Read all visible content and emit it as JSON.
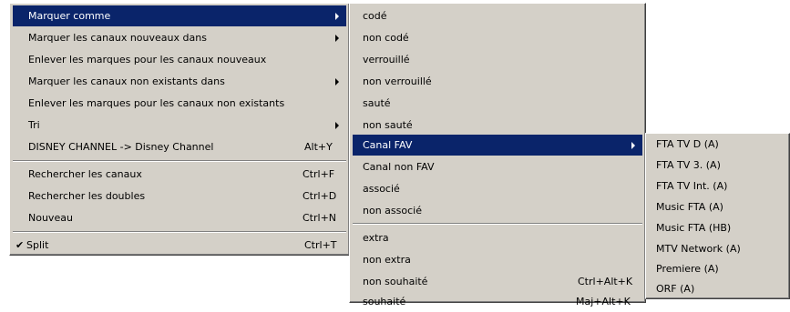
{
  "menu1": {
    "items": [
      {
        "label": "Marquer comme"
      },
      {
        "label": "Marquer les canaux nouveaux dans"
      },
      {
        "label": "Enlever les marques pour les canaux nouveaux"
      },
      {
        "label": "Marquer les canaux non existants dans"
      },
      {
        "label": "Enlever les marques pour les canaux non existants"
      },
      {
        "label": "Tri"
      },
      {
        "label": "DISNEY CHANNEL -> Disney Channel",
        "shortcut": "Alt+Y"
      },
      {
        "label": "Rechercher les canaux",
        "shortcut": "Ctrl+F"
      },
      {
        "label": "Rechercher les doubles",
        "shortcut": "Ctrl+D"
      },
      {
        "label": "Nouveau",
        "shortcut": "Ctrl+N"
      },
      {
        "label": "Split",
        "shortcut": "Ctrl+T",
        "check": "✔"
      }
    ]
  },
  "menu2": {
    "items": [
      {
        "label": "codé"
      },
      {
        "label": "non codé"
      },
      {
        "label": "verrouillé"
      },
      {
        "label": "non verrouillé"
      },
      {
        "label": "sauté"
      },
      {
        "label": "non sauté"
      },
      {
        "label": "Canal FAV"
      },
      {
        "label": "Canal non FAV"
      },
      {
        "label": "associé"
      },
      {
        "label": "non associé"
      },
      {
        "label": "extra"
      },
      {
        "label": "non extra"
      },
      {
        "label": "non souhaité",
        "shortcut": "Ctrl+Alt+K"
      },
      {
        "label": "souhaité",
        "shortcut": "Maj+Alt+K"
      }
    ]
  },
  "menu3": {
    "items": [
      {
        "label": "FTA TV D (A)"
      },
      {
        "label": "FTA TV 3. (A)"
      },
      {
        "label": "FTA TV Int. (A)"
      },
      {
        "label": "Music FTA (A)"
      },
      {
        "label": "Music FTA (HB)"
      },
      {
        "label": "MTV Network (A)"
      },
      {
        "label": "Premiere (A)"
      },
      {
        "label": "ORF (A)"
      }
    ]
  },
  "colors": {
    "menu_bg": "#d4d0c8",
    "highlight": "#0a246a",
    "highlight_text": "#ffffff"
  }
}
